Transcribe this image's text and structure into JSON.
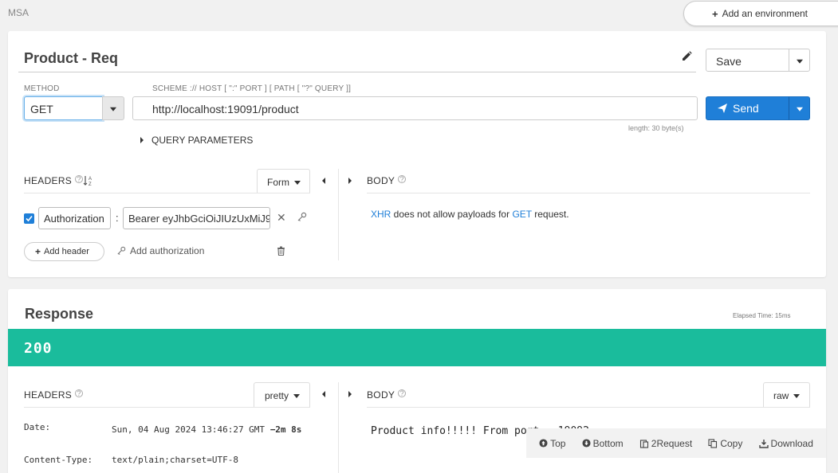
{
  "breadcrumb": "MSA",
  "env_button": "Add an environment",
  "request": {
    "title": "Product - Req",
    "save_label": "Save",
    "method_label": "METHOD",
    "scheme_label": "SCHEME :// HOST [ \":\" PORT ] [ PATH [ \"?\" QUERY ]]",
    "method": "GET",
    "url": "http://localhost:19091/product",
    "url_length": "length: 30 byte(s)",
    "send_label": "Send",
    "query_params_label": "QUERY PARAMETERS",
    "headers_label": "HEADERS",
    "headers_mode": "Form",
    "body_label": "BODY",
    "headers": [
      {
        "enabled": true,
        "name": "Authorization",
        "value": "Bearer eyJhbGciOiJIUzUxMiJ9"
      }
    ],
    "add_header_label": "Add header",
    "add_auth_label": "Add authorization",
    "payload_msg_pre": "XHR",
    "payload_msg_mid": " does not allow payloads for ",
    "payload_msg_method": "GET",
    "payload_msg_post": " request."
  },
  "response": {
    "title": "Response",
    "elapsed": "Elapsed Time: 15ms",
    "status": "200",
    "headers_label": "HEADERS",
    "headers_mode": "pretty",
    "body_label": "BODY",
    "body_mode": "raw",
    "headers": [
      {
        "key": "Date:",
        "value": "Sun, 04 Aug 2024 13:46:27 GMT",
        "note": "−2m 8s"
      },
      {
        "key": "Content-Type:",
        "value": "text/plain;charset=UTF-8"
      }
    ],
    "body": "Product info!!!!! From port : 19092"
  },
  "toolbar": {
    "top": "Top",
    "bottom": "Bottom",
    "to_request": "2Request",
    "copy": "Copy",
    "download": "Download"
  },
  "colors": {
    "accent": "#1f7fd8",
    "status_ok": "#1abc9c"
  }
}
